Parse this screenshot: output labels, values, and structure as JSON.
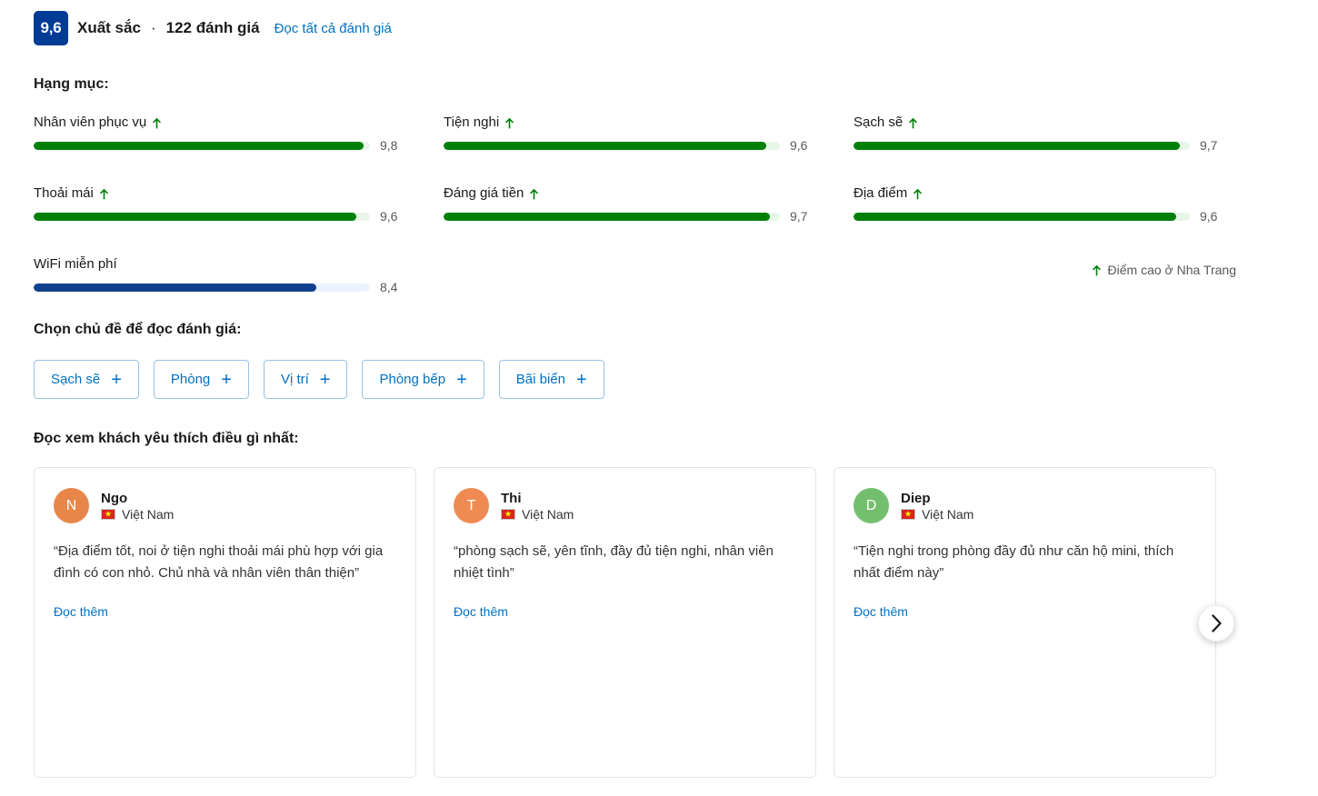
{
  "header": {
    "score": "9,6",
    "score_word": "Xuất sắc",
    "separator": "·",
    "review_count": "122 đánh giá",
    "all_reviews_link": "Đọc tất cả đánh giá",
    "badge_color": "#003b95",
    "link_color": "#0071c2"
  },
  "categories": {
    "title": "Hạng mục:",
    "high_score_note": "Điểm cao ở Nha Trang",
    "bar_color": "#008009",
    "bar_track_color": "#e7f6e7",
    "wifi_bar_color": "#10428b",
    "wifi_track_color": "#ebf3ff",
    "items": [
      {
        "label": "Nhân viên phục vụ",
        "score": "9,8",
        "value": 9.8,
        "high": true,
        "variant": "green"
      },
      {
        "label": "Tiện nghi",
        "score": "9,6",
        "value": 9.6,
        "high": true,
        "variant": "green"
      },
      {
        "label": "Sạch sẽ",
        "score": "9,7",
        "value": 9.7,
        "high": true,
        "variant": "green"
      },
      {
        "label": "Thoải mái",
        "score": "9,6",
        "value": 9.6,
        "high": true,
        "variant": "green"
      },
      {
        "label": "Đáng giá tiền",
        "score": "9,7",
        "value": 9.7,
        "high": true,
        "variant": "green"
      },
      {
        "label": "Địa điểm",
        "score": "9,6",
        "value": 9.6,
        "high": true,
        "variant": "green"
      },
      {
        "label": "WiFi miễn phí",
        "score": "8,4",
        "value": 8.4,
        "high": false,
        "variant": "wifi"
      }
    ]
  },
  "chart_data": {
    "type": "bar",
    "title": "Hạng mục:",
    "xlabel": "",
    "ylabel": "",
    "ylim": [
      0,
      10
    ],
    "grid": false,
    "legend": "Điểm cao ở Nha Trang",
    "orientation": "horizontal",
    "categories": [
      "Nhân viên phục vụ",
      "Tiện nghi",
      "Sạch sẽ",
      "Thoải mái",
      "Đáng giá tiền",
      "Địa điểm",
      "WiFi miễn phí"
    ],
    "values": [
      9.8,
      9.6,
      9.7,
      9.6,
      9.7,
      9.6,
      8.4
    ],
    "value_labels": [
      "9,8",
      "9,6",
      "9,7",
      "9,6",
      "9,7",
      "9,6",
      "8,4"
    ],
    "overall_score": 9.6,
    "overall_label": "9,6",
    "review_count": 122
  },
  "topics": {
    "title": "Chọn chủ đề để đọc đánh giá:",
    "chips": [
      {
        "label": "Sạch sẽ",
        "icon": "plus-icon",
        "glyph": "+"
      },
      {
        "label": "Phòng",
        "icon": "plus-icon",
        "glyph": "+"
      },
      {
        "label": "Vị trí",
        "icon": "plus-icon",
        "glyph": "+"
      },
      {
        "label": "Phòng bếp",
        "icon": "plus-icon",
        "glyph": "+"
      },
      {
        "label": "Bãi biển",
        "icon": "plus-icon",
        "glyph": "+"
      }
    ]
  },
  "reviews": {
    "title": "Đọc xem khách yêu thích điều gì nhất:",
    "read_more_label": "Đọc thêm",
    "cards": [
      {
        "initial": "N",
        "name": "Ngo",
        "country": "Việt Nam",
        "avatar_color": "#e8864a",
        "text": "“Địa điểm tốt, noi ở tiện nghi thoải mái phù hợp với gia đình có con nhỏ. Chủ nhà và nhân viên thân thiện”",
        "read_more": "Đọc thêm"
      },
      {
        "initial": "T",
        "name": "Thi",
        "country": "Việt Nam",
        "avatar_color": "#ef8b52",
        "text": "“phòng sạch sẽ, yên tĩnh, đầy đủ tiện nghi, nhân viên nhiệt tình”",
        "read_more": "Đọc thêm"
      },
      {
        "initial": "D",
        "name": "Diep",
        "country": "Việt Nam",
        "avatar_color": "#74bf6e",
        "text": "“Tiện nghi trong phòng đầy đủ như căn hộ mini, thích nhất điểm này”",
        "read_more": "Đọc thêm"
      }
    ],
    "next_button_icon": "chevron-right-icon"
  }
}
